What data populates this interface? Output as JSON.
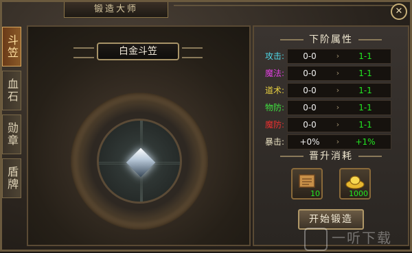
{
  "window": {
    "title": "锻造大师",
    "close_glyph": "✕"
  },
  "tabs": [
    {
      "label": "斗笠",
      "active": true
    },
    {
      "label": "血石",
      "active": false
    },
    {
      "label": "勋章",
      "active": false
    },
    {
      "label": "盾牌",
      "active": false
    }
  ],
  "item": {
    "name": "白金斗笠"
  },
  "next_attrs": {
    "title": "下阶属性",
    "rows": [
      {
        "label": "攻击:",
        "label_color": "#4fd8e8",
        "current": "0-0",
        "next": "1-1"
      },
      {
        "label": "魔法:",
        "label_color": "#e040e0",
        "current": "0-0",
        "next": "1-1"
      },
      {
        "label": "道术:",
        "label_color": "#e8d040",
        "current": "0-0",
        "next": "1-1"
      },
      {
        "label": "物防:",
        "label_color": "#40e040",
        "current": "0-0",
        "next": "1-1"
      },
      {
        "label": "魔防:",
        "label_color": "#e83030",
        "current": "0-0",
        "next": "1-1"
      },
      {
        "label": "暴击:",
        "label_color": "#e8e0c0",
        "current": "+0%",
        "next": "+1%"
      }
    ],
    "arrow_glyph": "›"
  },
  "cost": {
    "title": "晋升消耗",
    "items": [
      {
        "icon": "scroll-icon",
        "qty": "10"
      },
      {
        "icon": "gold-ingot-icon",
        "qty": "1000"
      }
    ]
  },
  "forge_button": {
    "label": "开始锻造"
  },
  "watermark": {
    "text": "一听下载"
  }
}
